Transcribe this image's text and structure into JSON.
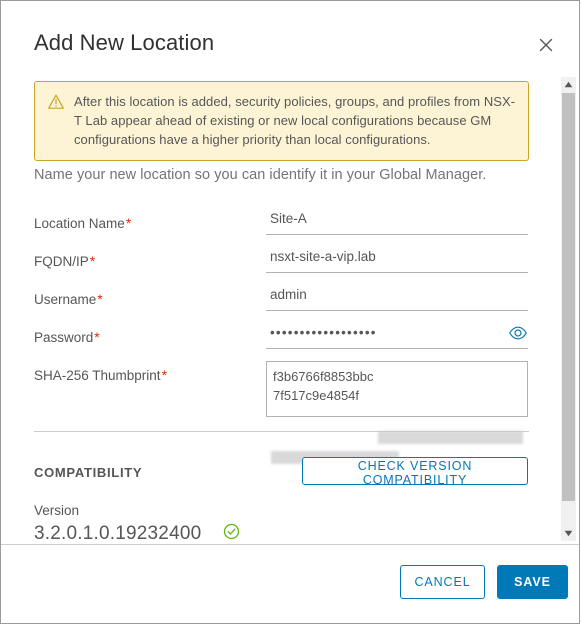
{
  "dialog": {
    "title": "Add New Location",
    "close_icon": "close-icon"
  },
  "alert": {
    "icon": "warning-triangle-icon",
    "text": "After this location is added, security policies, groups, and profiles from NSX-T Lab appear ahead of existing or new local configurations because GM configurations have a higher priority than local configurations.",
    "background_color": "#fdf4d6",
    "border_color": "#c8a621"
  },
  "intro_text": "Name your new location so you can identify it in your Global Manager.",
  "form": {
    "location_name": {
      "label": "Location Name",
      "required": "*",
      "value": "Site-A",
      "placeholder": ""
    },
    "fqdn_ip": {
      "label": "FQDN/IP",
      "required": "*",
      "value": "nsxt-site-a-vip.lab",
      "placeholder": ""
    },
    "username": {
      "label": "Username",
      "required": "*",
      "value": "admin",
      "placeholder": ""
    },
    "password": {
      "label": "Password",
      "required": "*",
      "value": "••••••••••••••••••",
      "placeholder": "",
      "reveal_icon": "eye-icon"
    },
    "thumbprint": {
      "label": "SHA-256 Thumbprint",
      "required": "*",
      "value": "f3b6766f8853bbc                                         7f517c9e4854f",
      "placeholder": ""
    }
  },
  "compatibility": {
    "heading": "COMPATIBILITY",
    "check_button": "CHECK VERSION COMPATIBILITY",
    "version_label": "Version",
    "version_value": "3.2.0.1.0.19232400",
    "status_icon": "check-circle-icon",
    "status_color": "#60b515"
  },
  "scrollbar": {
    "up_icon": "caret-up-icon",
    "down_icon": "caret-down-icon"
  },
  "footer": {
    "cancel_label": "CANCEL",
    "save_label": "SAVE"
  },
  "colors": {
    "accent": "#0079b8",
    "required": "#e62700",
    "text": "#565656"
  }
}
